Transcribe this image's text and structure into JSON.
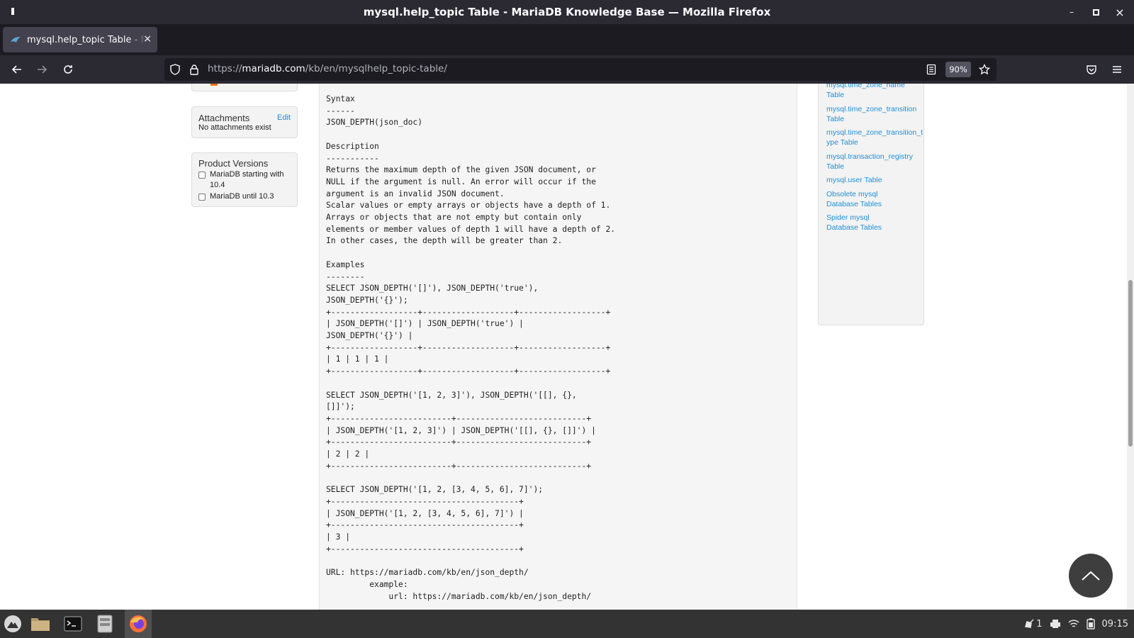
{
  "window": {
    "title": "mysql.help_topic Table - MariaDB Knowledge Base — Mozilla Firefox",
    "controls": {
      "minimize": "–",
      "maximize": "▫",
      "close": "×"
    }
  },
  "tab": {
    "label": "mysql.help_topic Table - MariaDB Knowledge Base",
    "close": "×",
    "new_tab": "+"
  },
  "nav": {
    "url_prefix": "https://",
    "url_domain": "mariadb.com",
    "url_path": "/kb/en/mysqlhelp_topic-table/",
    "zoom": "90%"
  },
  "left_sidebar": {
    "attachments": {
      "title": "Attachments",
      "edit": "Edit",
      "text": "No attachments exist"
    },
    "product_versions": {
      "title": "Product Versions",
      "options": [
        "MariaDB starting with 10.4",
        "MariaDB until 10.3"
      ]
    }
  },
  "content": {
    "code": "Syntax\n------\nJSON_DEPTH(json_doc)\n\nDescription\n-----------\nReturns the maximum depth of the given JSON document, or\nNULL if the argument is null. An error will occur if the\nargument is an invalid JSON document.\nScalar values or empty arrays or objects have a depth of 1.\nArrays or objects that are not empty but contain only\nelements or member values of depth 1 will have a depth of 2.\nIn other cases, the depth will be greater than 2.\n\nExamples\n--------\nSELECT JSON_DEPTH('[]'), JSON_DEPTH('true'),\nJSON_DEPTH('{}');\n+------------------+-------------------+------------------+\n| JSON_DEPTH('[]') | JSON_DEPTH('true') |\nJSON_DEPTH('{}') |\n+------------------+-------------------+------------------+\n| 1 | 1 | 1 |\n+------------------+-------------------+------------------+\n\nSELECT JSON_DEPTH('[1, 2, 3]'), JSON_DEPTH('[[], {},\n[]]');\n+-------------------------+---------------------------+\n| JSON_DEPTH('[1, 2, 3]') | JSON_DEPTH('[[], {}, []]') |\n+-------------------------+---------------------------+\n| 2 | 2 |\n+-------------------------+---------------------------+\n\nSELECT JSON_DEPTH('[1, 2, [3, 4, 5, 6], 7]');\n+---------------------------------------+\n| JSON_DEPTH('[1, 2, [3, 4, 5, 6], 7]') |\n+---------------------------------------+\n| 3 |\n+---------------------------------------+\n\nURL: https://mariadb.com/kb/en/json_depth/\n         example:\n             url: https://mariadb.com/kb/en/json_depth/"
  },
  "right_sidebar": {
    "links": [
      "mysql.time_zone_name Table",
      "mysql.time_zone_transition Table",
      "mysql.time_zone_transition_type Table",
      "mysql.transaction_registry Table",
      "mysql.user Table",
      "Obsolete mysql Database Tables",
      "Spider mysql Database Tables"
    ]
  },
  "taskbar": {
    "notification_count": "1",
    "clock": "09:15"
  }
}
